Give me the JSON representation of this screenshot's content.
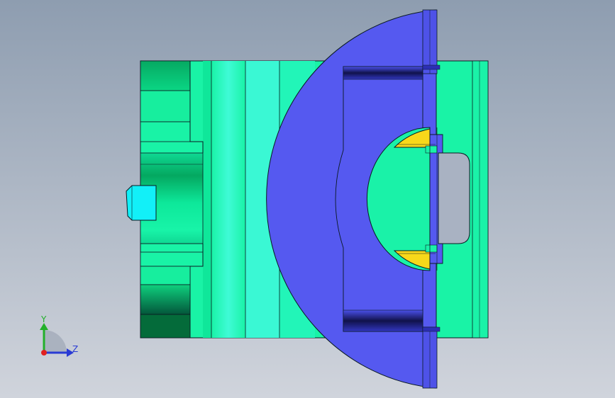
{
  "viewport": {
    "background_top": "#8e9db0",
    "background_bottom": "#d0d4dc"
  },
  "model": {
    "colors": {
      "body_green": "#19f3a6",
      "dark_green": "#04b86a",
      "darker_green": "#046b3a",
      "cyan_band": "#2ff8d8",
      "cyan_part": "#12f0f8",
      "blue_part": "#5559f0",
      "blue_dark": "#2c2fb4",
      "yellow_part": "#f8d81a",
      "edge": "#0a1a22"
    }
  },
  "triad": {
    "y_label": "Y",
    "z_label": "Z",
    "y_color": "#22b02a",
    "z_color": "#2a3bd4",
    "origin_color": "#e02020"
  }
}
